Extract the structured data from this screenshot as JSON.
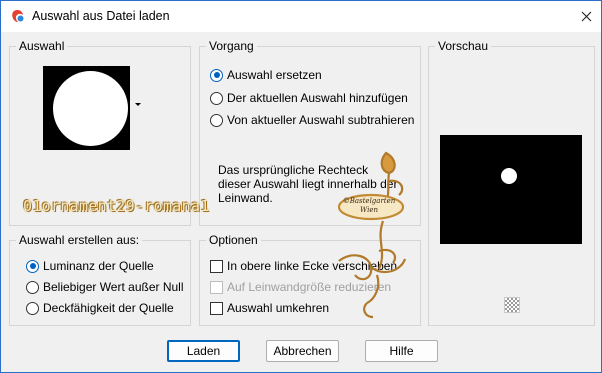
{
  "window": {
    "title": "Auswahl aus Datei laden",
    "close_glyph": "✕"
  },
  "groups": {
    "auswahl": "Auswahl",
    "vorgang": "Vorgang",
    "vorschau": "Vorschau",
    "erstellen": "Auswahl erstellen aus:",
    "optionen": "Optionen"
  },
  "vorgang": {
    "options": [
      {
        "label": "Auswahl ersetzen",
        "selected": true
      },
      {
        "label": "Der aktuellen Auswahl hinzufügen",
        "selected": false
      },
      {
        "label": "Von aktueller Auswahl subtrahieren",
        "selected": false
      }
    ],
    "info": "Das ursprüngliche Rechteck dieser Auswahl liegt innerhalb der Leinwand."
  },
  "erstellen": {
    "options": [
      {
        "label": "Luminanz der Quelle",
        "selected": true
      },
      {
        "label": "Beliebiger Wert außer Null",
        "selected": false
      },
      {
        "label": "Deckfähigkeit der Quelle",
        "selected": false
      }
    ]
  },
  "optionen": {
    "items": [
      {
        "label": "In obere linke Ecke verschieben",
        "checked": false,
        "enabled": true
      },
      {
        "label": "Auf Leinwandgröße reduzieren",
        "checked": false,
        "enabled": false
      },
      {
        "label": "Auswahl umkehren",
        "checked": false,
        "enabled": true
      }
    ]
  },
  "buttons": {
    "laden": "Laden",
    "abbrechen": "Abbrechen",
    "hilfe": "Hilfe"
  },
  "overlay": {
    "watermark": "01ornament29-romana1",
    "stamp_line1": "©Bastelgarten",
    "stamp_line2": "Wien"
  },
  "colors": {
    "accent": "#0067c0",
    "frame": "#2b6fc7"
  },
  "icons": {
    "app": "paintshop-icon",
    "close": "close-icon",
    "dropdown": "chevron-down-icon",
    "checker": "transparency-checker-icon"
  }
}
